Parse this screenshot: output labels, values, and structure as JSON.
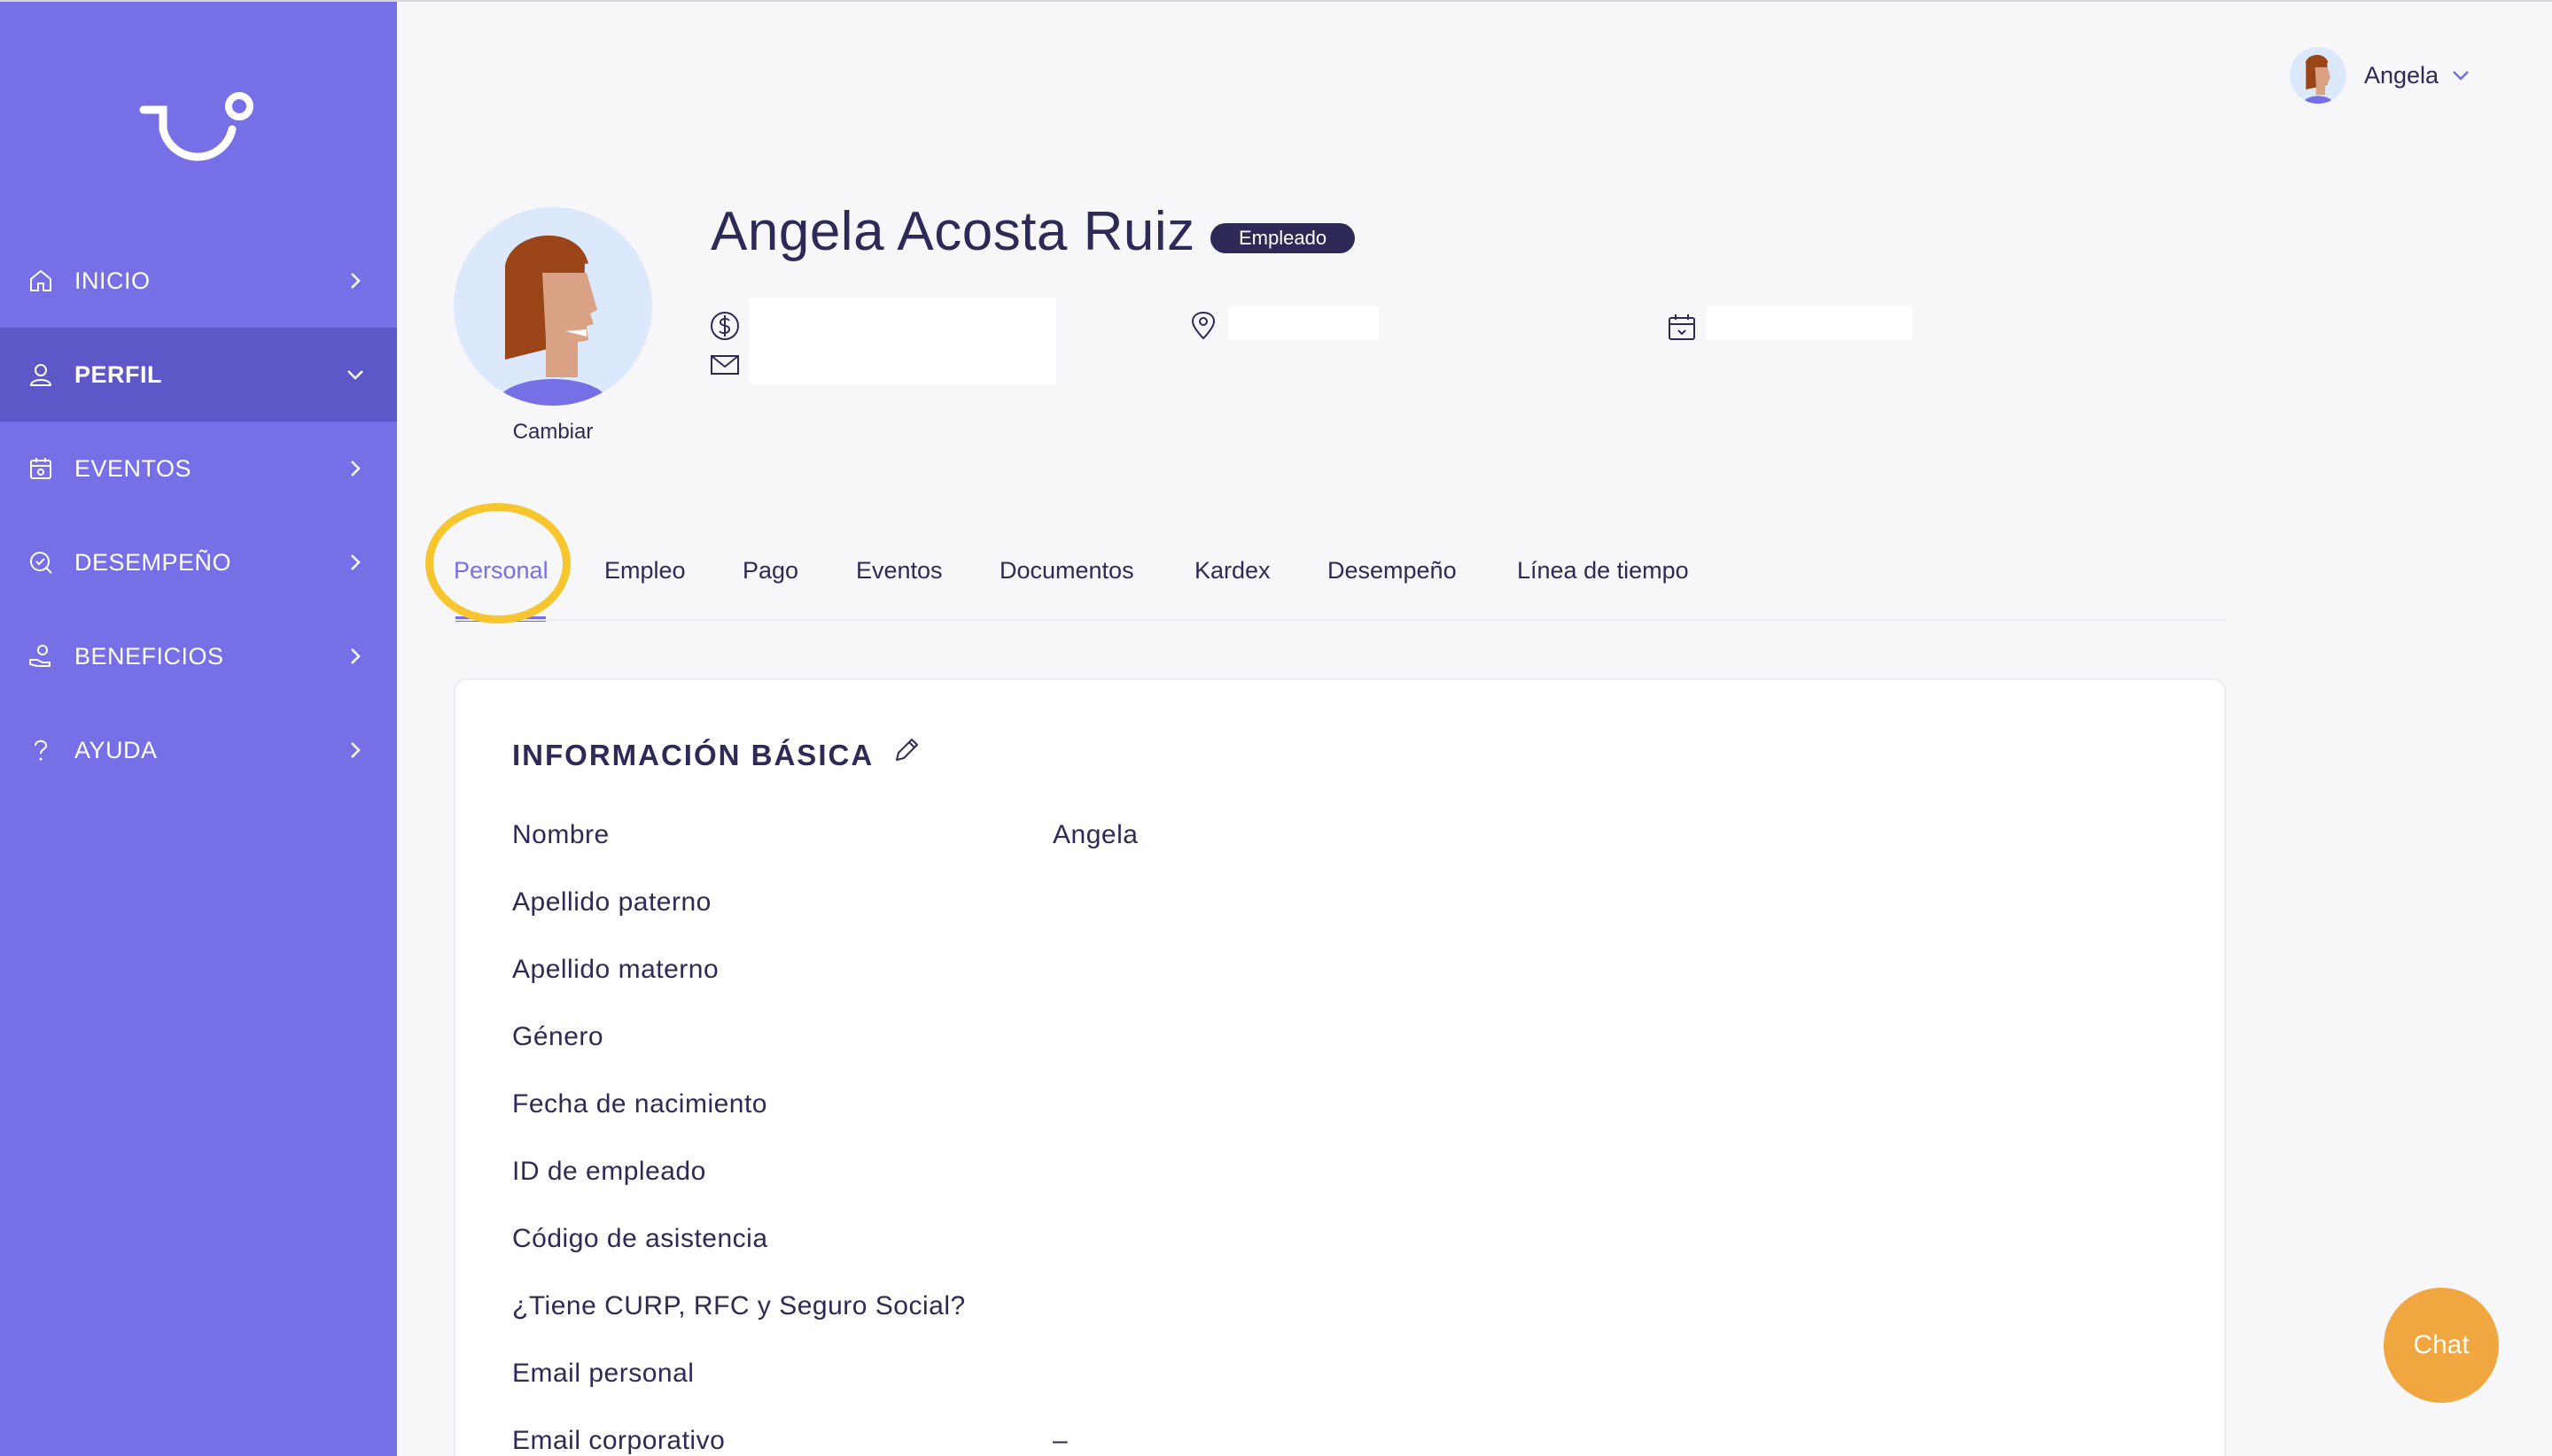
{
  "colors": {
    "sidebar": "#766fe6",
    "sidebar_active": "#5e57c8",
    "accent": "#766fe6",
    "text": "#2e2a57",
    "highlight": "#f7c52e",
    "chat": "#f0a73f"
  },
  "sidebar": {
    "logo": "brand-logo",
    "items": [
      {
        "label": "INICIO",
        "icon": "home-icon",
        "active": false
      },
      {
        "label": "PERFIL",
        "icon": "user-icon",
        "active": true
      },
      {
        "label": "EVENTOS",
        "icon": "calendar-icon",
        "active": false
      },
      {
        "label": "DESEMPEÑO",
        "icon": "performance-icon",
        "active": false
      },
      {
        "label": "BENEFICIOS",
        "icon": "benefits-icon",
        "active": false
      },
      {
        "label": "AYUDA",
        "icon": "help-icon",
        "active": false
      }
    ]
  },
  "header": {
    "user_name": "Angela"
  },
  "profile": {
    "full_name": "Angela Acosta Ruiz",
    "role_badge": "Empleado",
    "change_photo": "Cambiar"
  },
  "tabs": {
    "items": [
      "Personal",
      "Empleo",
      "Pago",
      "Eventos",
      "Documentos",
      "Kardex",
      "Desempeño",
      "Línea de tiempo"
    ],
    "active": "Personal"
  },
  "basic_info": {
    "title": "INFORMACIÓN BÁSICA",
    "fields": [
      {
        "label": "Nombre",
        "value": "Angela"
      },
      {
        "label": "Apellido paterno",
        "value": ""
      },
      {
        "label": "Apellido materno",
        "value": ""
      },
      {
        "label": "Género",
        "value": ""
      },
      {
        "label": "Fecha de nacimiento",
        "value": ""
      },
      {
        "label": "ID de empleado",
        "value": ""
      },
      {
        "label": "Código de asistencia",
        "value": ""
      },
      {
        "label": "¿Tiene CURP, RFC y Seguro Social?",
        "value": ""
      },
      {
        "label": "Email personal",
        "value": ""
      },
      {
        "label": "Email corporativo",
        "value": "–"
      }
    ]
  },
  "chat": {
    "label": "Chat"
  }
}
